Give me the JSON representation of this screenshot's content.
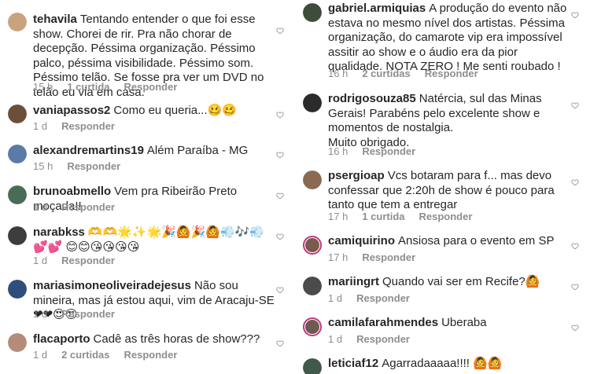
{
  "left": [
    {
      "user": "tehavila",
      "text": "Tentando entender o que foi esse show. Chorei de rir. Pra não chorar de decepção. Péssima organização. Péssimo palco, péssima visibilidade. Péssimo som. Péssimo telão. Se fosse pra ver um DVD no telão eu via em casa.",
      "time": "15 h",
      "likes": "1 curtida",
      "reply": "Responder",
      "avatar_color": "#c9a27e"
    },
    {
      "user": "vaniapassos2",
      "text": "Como eu queria...🥴🥴",
      "time": "1 d",
      "likes": "",
      "reply": "Responder",
      "avatar_color": "#6b4f3a"
    },
    {
      "user": "alexandremartins19",
      "text": "Além Paraíba - MG",
      "time": "15 h",
      "likes": "",
      "reply": "Responder",
      "avatar_color": "#5b7aa6"
    },
    {
      "user": "brunoabmello",
      "text": "Vem pra Ribeirão Preto moçada!!",
      "time": "1 d",
      "likes": "",
      "reply": "Responder",
      "avatar_color": "#4a6b55"
    },
    {
      "user": "narabkss",
      "text": "🫶🫶🌟✨🌟🎉🙆🎉🙆💨🎶💨💕💕 😊😊😘😘😘😘",
      "time": "1 d",
      "likes": "",
      "reply": "Responder",
      "avatar_color": "#3d3d3d"
    },
    {
      "user": "mariasimoneoliveiradejesus",
      "text": "Não sou mineira, mas já estou aqui, vim de Aracaju-SE❤❤😍😍",
      "time": "1 d",
      "likes": "",
      "reply": "Responder",
      "avatar_color": "#2f4e7a"
    },
    {
      "user": "flacaporto",
      "text": "Cadê as três horas de show???",
      "time": "1 d",
      "likes": "2 curtidas",
      "reply": "Responder",
      "avatar_color": "#b58b7a"
    }
  ],
  "right": [
    {
      "user": "gabriel.armiquias",
      "text": "A produção do evento não estava no mesmo nível dos artistas. Péssima organização, do camarote vip era impossível assitir ao show e o áudio era da pior qualidade. NOTA ZERO ! Me senti roubado !",
      "time": "16 h",
      "likes": "2 curtidas",
      "reply": "Responder",
      "avatar_color": "#3c4d3a"
    },
    {
      "user": "rodrigosouza85",
      "text": "Natércia, sul das Minas Gerais! Parabéns pelo excelente show e momentos de nostalgia.\nMuito obrigado.",
      "time": "16 h",
      "likes": "",
      "reply": "Responder",
      "avatar_color": "#2b2b2b"
    },
    {
      "user": "psergioap",
      "text": "Vcs botaram para f... mas devo confessar que 2:20h de show é pouco para tanto que tem a entregar",
      "time": "17 h",
      "likes": "1 curtida",
      "reply": "Responder",
      "avatar_color": "#8a6b52"
    },
    {
      "user": "camiquirino",
      "text": "Ansiosa para o evento em SP",
      "time": "17 h",
      "likes": "",
      "reply": "Responder",
      "avatar_color": "#7a5a4c"
    },
    {
      "user": "mariingrt",
      "text": "Quando vai ser em Recife?🙆",
      "time": "1 d",
      "likes": "",
      "reply": "Responder",
      "avatar_color": "#4b4b4b"
    },
    {
      "user": "camilafarahmendes",
      "text": "Uberaba",
      "time": "1 d",
      "likes": "",
      "reply": "Responder",
      "avatar_color": "#6d5a50"
    },
    {
      "user": "leticiaf12",
      "text": "Agarradaaaaa!!!! 🙆🙆",
      "time": "",
      "likes": "",
      "reply": "",
      "avatar_color": "#3f5a4a"
    }
  ]
}
